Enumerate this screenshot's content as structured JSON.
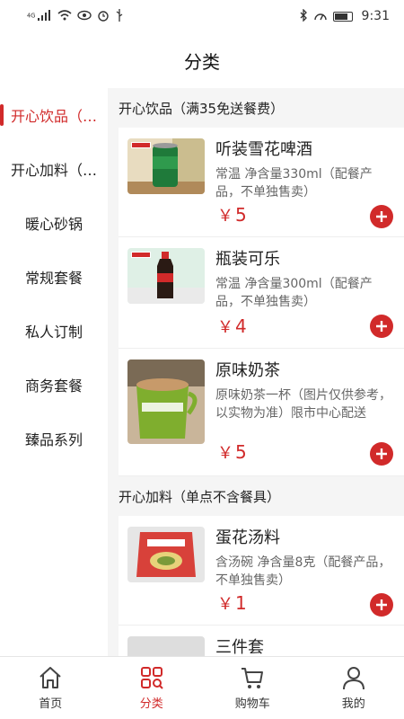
{
  "status": {
    "left_icons": [
      "signal-4g-icon",
      "wifi-icon",
      "eye-icon",
      "alarm-icon",
      "usb-icon"
    ],
    "signal_label": "4G",
    "time": "9:31"
  },
  "header": {
    "title": "分类"
  },
  "sidebar": {
    "items": [
      {
        "label": "开心饮品（…"
      },
      {
        "label": "开心加料（…"
      },
      {
        "label": "暖心砂锅"
      },
      {
        "label": "常规套餐"
      },
      {
        "label": "私人订制"
      },
      {
        "label": "商务套餐"
      },
      {
        "label": "臻品系列"
      }
    ]
  },
  "sections": [
    {
      "title": "开心饮品（满35免送餐费）",
      "products": [
        {
          "name": "听装雪花啤酒",
          "desc": "常温 净含量330ml（配餐产品，不单独售卖）",
          "currency": "￥",
          "price": "5"
        },
        {
          "name": "瓶装可乐",
          "desc": "常温 净含量300ml（配餐产品，不单独售卖）",
          "currency": "￥",
          "price": "4"
        },
        {
          "name": "原味奶茶",
          "desc": "原味奶茶一杯（图片仅供参考，以实物为准）限市中心配送",
          "currency": "￥",
          "price": "5"
        }
      ]
    },
    {
      "title": "开心加料（单点不含餐具）",
      "products": [
        {
          "name": "蛋花汤料",
          "desc": "含汤碗 净含量8克（配餐产品，不单独售卖）",
          "currency": "￥",
          "price": "1"
        },
        {
          "name": "三件套",
          "desc": "",
          "currency": "",
          "price": ""
        }
      ]
    }
  ],
  "tabbar": {
    "items": [
      {
        "label": "首页",
        "icon": "home-icon"
      },
      {
        "label": "分类",
        "icon": "category-icon"
      },
      {
        "label": "购物车",
        "icon": "cart-icon"
      },
      {
        "label": "我的",
        "icon": "user-icon"
      }
    ]
  },
  "colors": {
    "accent": "#d12a2a",
    "content_bg": "#f5f5f5"
  }
}
